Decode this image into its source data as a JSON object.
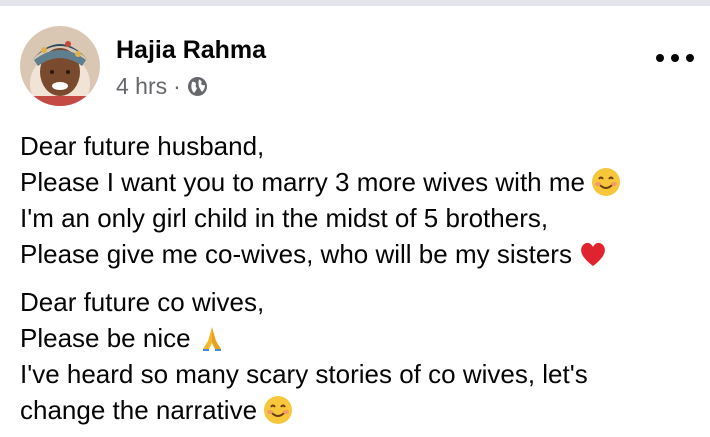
{
  "post": {
    "author": "Hajia Rahma",
    "time": "4 hrs",
    "separator": "·",
    "privacy_icon": "globe-icon",
    "more_icon": "more-options-icon"
  },
  "content": {
    "para1": {
      "line1": "Dear future husband,",
      "line2": "Please I want you to marry 3 more wives with me",
      "line3": "I'm an only girl child in the midst of 5 brothers,",
      "line4": "Please give me co-wives, who will be my sisters"
    },
    "para2": {
      "line1": "Dear future co wives,",
      "line2": "Please be nice",
      "line3": "I've heard so many scary stories of co wives, let's",
      "line4": "change the narrative"
    },
    "emojis": [
      "smiling-face-icon",
      "red-heart-icon",
      "folded-hands-icon",
      "smiling-face-icon"
    ]
  },
  "colors": {
    "text": "#050505",
    "secondary": "#65676b",
    "divider": "#e4e6eb"
  }
}
